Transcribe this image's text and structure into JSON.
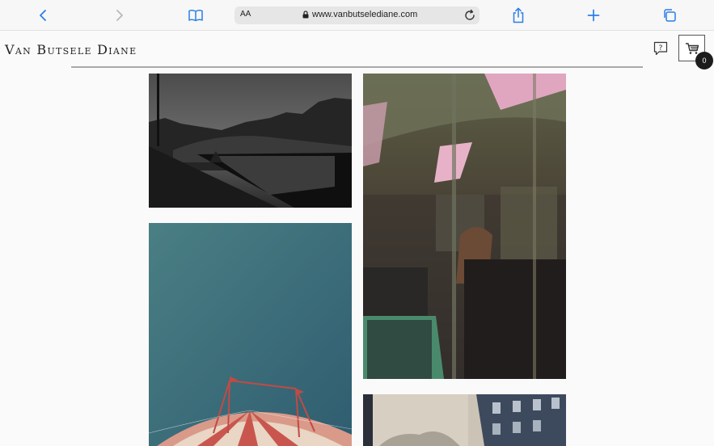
{
  "browser": {
    "url_text": "www.vanbutselediane.com",
    "reader_label": "AA",
    "icons": [
      "back-icon",
      "forward-icon",
      "bookmarks-icon",
      "lock-icon",
      "reload-icon",
      "share-icon",
      "new-tab-icon",
      "tabs-icon"
    ]
  },
  "site": {
    "title": "Van Butsele Diane",
    "cart_count": "0"
  },
  "gallery": {
    "photos": [
      {
        "subject": "river-bridge-night"
      },
      {
        "subject": "tram-interior"
      },
      {
        "subject": "circus-tent-sky"
      },
      {
        "subject": "street-buildings"
      }
    ]
  },
  "colors": {
    "accent": "#2a7fe8",
    "badge": "#1c1c1c"
  }
}
